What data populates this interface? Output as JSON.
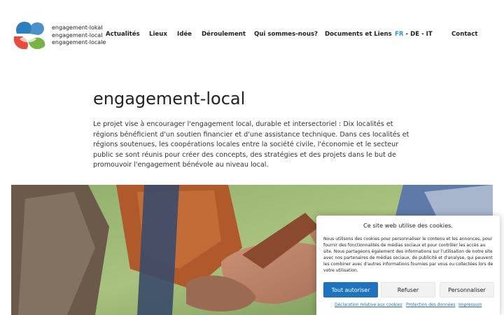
{
  "logo": {
    "lines": [
      "engagement-lokal",
      "engagement-local",
      "engagement-locale"
    ],
    "colors": [
      "#2a7fc1",
      "#e74c3c",
      "#7bb342"
    ]
  },
  "nav": {
    "items": [
      "Actualités",
      "Lieux",
      "Idée",
      "Déroulement",
      "Qui sommes-nous?",
      "Documents et Liens"
    ],
    "contact": "Contact"
  },
  "languages": {
    "active": "FR",
    "separator": "-",
    "options": [
      "DE",
      "IT"
    ],
    "active_color": "#2a9bc4"
  },
  "main": {
    "title": "engagement-local",
    "intro": "Le projet vise à encourager l'engagement local, durable et intersectoriel : Dix localités et régions bénéficient d'un soutien financier et d'une assistance technique. Dans ces localités et régions soutenues, les coopérations locales entre la société civile, l'économie et le secteur public se sont réunis pour créer des concepts, des stratégies et des projets dans le but de promouvoir l'engagement bénévole au niveau local."
  },
  "cookie_banner": {
    "title": "Ce site web utilise des cookies.",
    "body": "Nous utilisons des cookies pour personnaliser le contenu et les annonces, pour fournir des fonctionnalités de médias sociaux et pour contrôler les accès au site. Nous partageons également des informations sur l'utilisation de notre site avec nos partenaires de médias sociaux, de publicité et d'analyse, qui peuvent les combiner avec d'autres informations fournies par vous ou collectées lors de votre utilisation.",
    "accept_label": "Tout autoriser",
    "refuse_label": "Refuser",
    "customize_label": "Personnaliser",
    "links": [
      "Déclaration relative aux cookies",
      "Protection des données",
      "Impressum"
    ],
    "accent_color": "#1e73be"
  }
}
